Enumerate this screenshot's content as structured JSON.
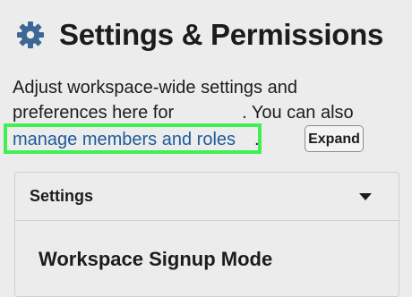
{
  "header": {
    "icon": "gear-icon",
    "title": "Settings & Permissions"
  },
  "intro": {
    "line1": "Adjust workspace-wide settings and",
    "line2_prefix": "preferences here for",
    "line2_suffix": ". You can also",
    "link_label": "manage members and roles",
    "link_suffix": "."
  },
  "panel": {
    "title": "Settings",
    "caret_icon": "caret-down-icon",
    "row_label": "Workspace Signup Mode",
    "expand_label": "Expand"
  },
  "colors": {
    "link": "#1e5b9a",
    "highlight": "#3ff052",
    "gear": "#3d6794"
  }
}
